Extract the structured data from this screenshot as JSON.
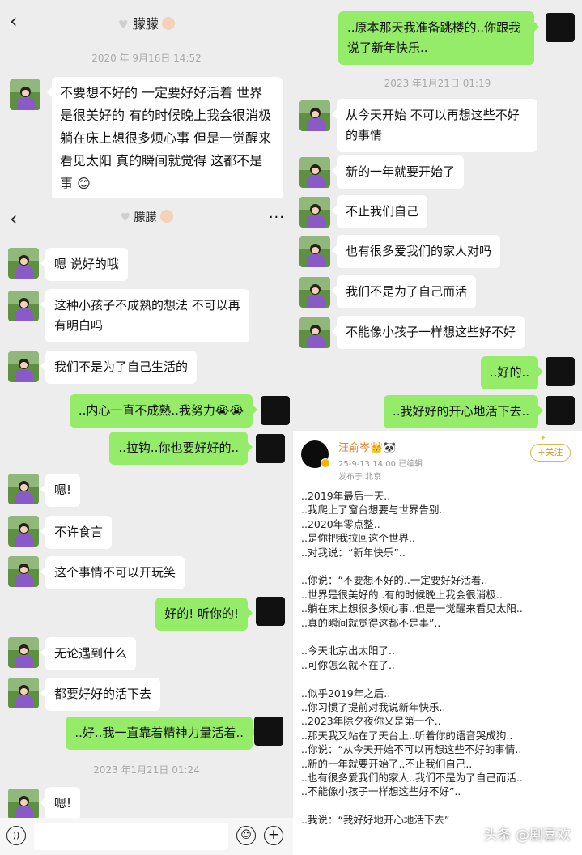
{
  "panel_a": {
    "contact": "朦朦",
    "timestamp": "2020 年 9月16日 14:52",
    "message": "不要想不好的 一定要好好活着 世界是很美好的 有的时候晚上我会很消极 躺在床上想很多烦心事 但是一觉醒来 看见太阳 真的瞬间就觉得 这都不是事 😊"
  },
  "panel_b": {
    "contact": "朦朦",
    "messages": [
      {
        "side": "left",
        "text": "嗯 说好的哦"
      },
      {
        "side": "left",
        "text": "这种小孩子不成熟的想法 不可以再有明白吗"
      },
      {
        "side": "left",
        "text": "我们不是为了自己生活的"
      },
      {
        "side": "right",
        "text": "..内心一直不成熟..我努力😭😭"
      },
      {
        "side": "right",
        "text": "..拉钩..你也要好好的.."
      },
      {
        "side": "left",
        "text": "嗯!"
      },
      {
        "side": "left",
        "text": "不许食言"
      },
      {
        "side": "left",
        "text": "这个事情不可以开玩笑"
      },
      {
        "side": "right",
        "text": "好的! 听你的!"
      },
      {
        "side": "left",
        "text": "无论遇到什么"
      },
      {
        "side": "left",
        "text": "都要好好的活下去"
      },
      {
        "side": "right",
        "text": "..好..我一直靠着精神力量活着.."
      },
      {
        "side": "left",
        "text": "嗯!"
      }
    ],
    "timestamp": "2023 年1月21日 01:24",
    "icons": {
      "voice": "voice-icon",
      "emoji": "emoji-icon",
      "plus": "plus-icon"
    }
  },
  "panel_c": {
    "top_message": "..原本那天我准备跳楼的..你跟我说了新年快乐..",
    "timestamp": "2023 年1月21日 01:19",
    "messages": [
      {
        "side": "left",
        "text": "从今天开始 不可以再想这些不好的事情"
      },
      {
        "side": "left",
        "text": "新的一年就要开始了"
      },
      {
        "side": "left",
        "text": "不止我们自己"
      },
      {
        "side": "left",
        "text": "也有很多爱我们的家人对吗"
      },
      {
        "side": "left",
        "text": "我们不是为了自己而活"
      },
      {
        "side": "left",
        "text": "不能像小孩子一样想这些好不好"
      },
      {
        "side": "right",
        "text": "..好的.."
      },
      {
        "side": "right",
        "text": "..我好好的开心地活下去.."
      }
    ]
  },
  "post": {
    "author": "汪俞岑👑🐼",
    "meta": "25-9-13 14:00 已编辑",
    "location": "发布于 北京",
    "follow_label": "+关注",
    "lines": [
      "..2019年最后一天..",
      "..我爬上了窗台想要与世界告别..",
      "..2020年零点整..",
      "..是你把我拉回这个世界..",
      "..对我说：“新年快乐”..",
      "",
      "..你说：“不要想不好的..一定要好好活着..",
      "..世界是很美好的..有的时候晚上我会很消极..",
      "..躺在床上想很多烦心事..但是一觉醒来看见太阳..",
      "..真的瞬间就觉得这都不是事”..",
      "",
      "..今天北京出太阳了..",
      "..可你怎么就不在了..",
      "",
      "..似乎2019年之后..",
      "..你习惯了提前对我说新年快乐..",
      "..2023年除夕夜你又是第一个..",
      "..那天我又站在了天台上..听着你的语音哭成狗..",
      "..你说：“从今天开始不可以再想这些不好的事情..",
      "..新的一年就要开始了..不止我们自己..",
      "..也有很多爱我们的家人..我们不是为了自己而活..",
      "..不能像小孩子一样想这些好不好”..",
      "",
      "..我说：“我好好地开心地活下去”"
    ]
  },
  "watermark": "头条 @剧喜欢"
}
